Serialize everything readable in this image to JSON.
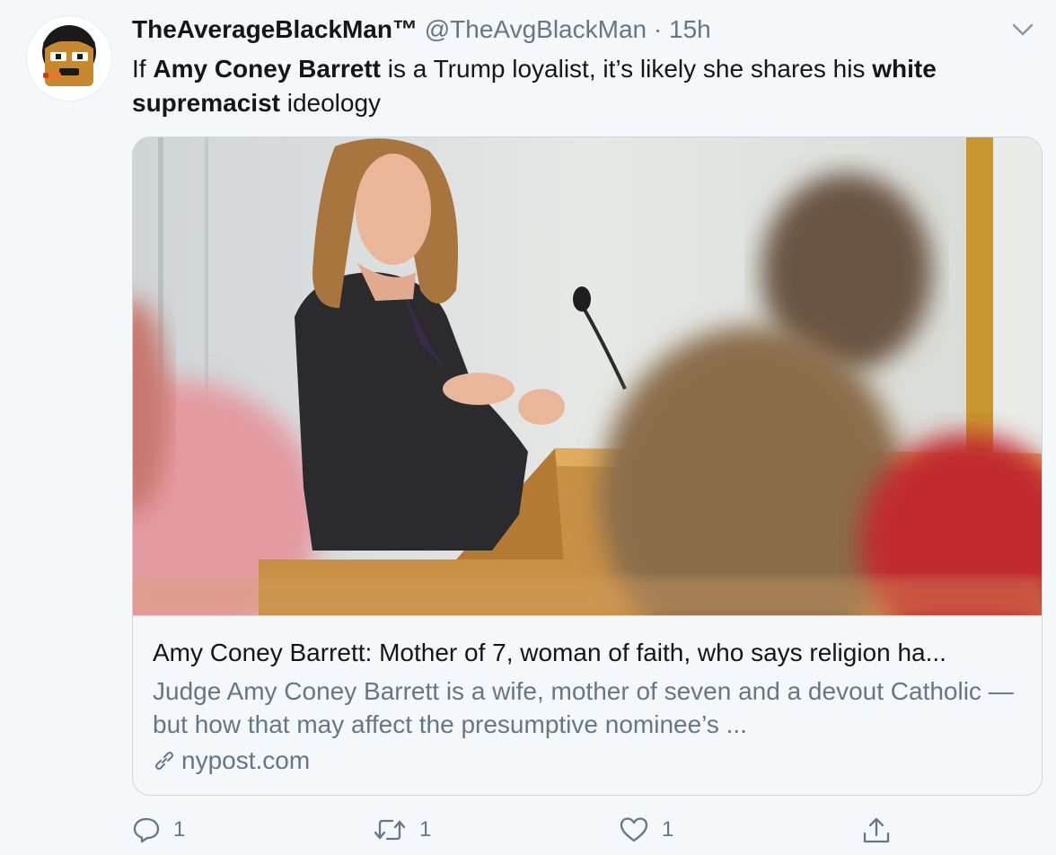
{
  "tweet": {
    "display_name": "TheAverageBlackMan™",
    "handle": "@TheAvgBlackMan",
    "separator": "·",
    "time": "15h",
    "text_parts": [
      "If ",
      "Amy Coney Barrett",
      " is a Trump loyalist, it’s likely she shares his ",
      "white supremacist",
      " ideology"
    ]
  },
  "card": {
    "title": "Amy Coney Barrett: Mother of 7, woman of faith, who says religion ha...",
    "description": "Judge Amy Coney Barrett is a wife, mother of seven and a devout Catholic — but how that may affect the presumptive nominee’s ...",
    "domain": "nypost.com"
  },
  "actions": {
    "reply_count": "1",
    "retweet_count": "1",
    "like_count": "1"
  },
  "icons": {
    "avatar": "cartoon-face-avatar",
    "caret": "chevron-down-icon",
    "link": "link-icon",
    "reply": "reply-icon",
    "retweet": "retweet-icon",
    "like": "heart-icon",
    "share": "share-icon"
  },
  "colors": {
    "background": "#f5f8fa",
    "text": "#14171a",
    "secondary": "#657786",
    "border": "#ccd6dd"
  }
}
